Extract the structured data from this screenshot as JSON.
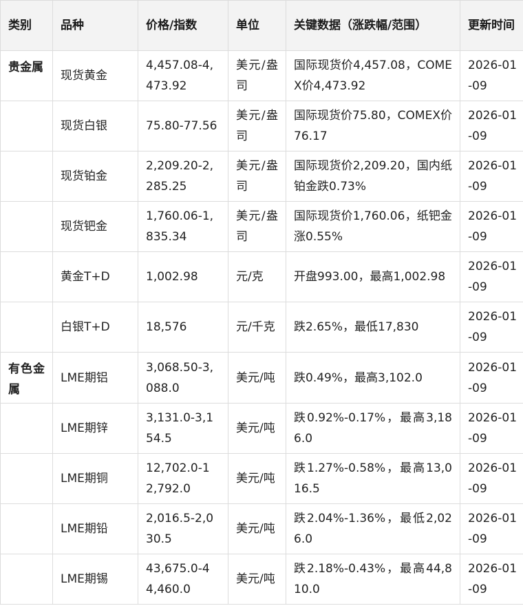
{
  "headers": [
    "类别",
    "品种",
    "价格/指数",
    "单位",
    "关键数据（涨跌幅/范围）",
    "更新时间"
  ],
  "rows": [
    {
      "category": "贵金属",
      "variety": "现货黄金",
      "price": "4,457.08-4,473.92",
      "unit": "美元/盎司",
      "key_data": "国际现货价4,457.08，COMEX价4,473.92",
      "updated": "2026-01-09"
    },
    {
      "category": "",
      "variety": "现货白银",
      "price": "75.80-77.56",
      "unit": "美元/盎司",
      "key_data": "国际现货价75.80，COMEX价76.17",
      "updated": "2026-01-09"
    },
    {
      "category": "",
      "variety": "现货铂金",
      "price": "2,209.20-2,285.25",
      "unit": "美元/盎司",
      "key_data": "国际现货价2,209.20，国内纸铂金跌0.73%",
      "updated": "2026-01-09"
    },
    {
      "category": "",
      "variety": "现货钯金",
      "price": "1,760.06-1,835.34",
      "unit": "美元/盎司",
      "key_data": "国际现货价1,760.06，纸钯金涨0.55%",
      "updated": "2026-01-09"
    },
    {
      "category": "",
      "variety": "黄金T+D",
      "price": "1,002.98",
      "unit": "元/克",
      "key_data": "开盘993.00，最高1,002.98",
      "updated": "2026-01-09"
    },
    {
      "category": "",
      "variety": "白银T+D",
      "price": "18,576",
      "unit": "元/千克",
      "key_data": "跌2.65%，最低17,830",
      "updated": "2026-01-09"
    },
    {
      "category": "有色金属",
      "variety": "LME期铝",
      "price": "3,068.50-3,088.0",
      "unit": "美元/吨",
      "key_data": "跌0.49%，最高3,102.0",
      "updated": "2026-01-09"
    },
    {
      "category": "",
      "variety": "LME期锌",
      "price": "3,131.0-3,154.5",
      "unit": "美元/吨",
      "key_data": "跌0.92%-0.17%，最高3,186.0",
      "updated": "2026-01-09"
    },
    {
      "category": "",
      "variety": "LME期铜",
      "price": "12,702.0-12,792.0",
      "unit": "美元/吨",
      "key_data": "跌1.27%-0.58%，最高13,016.5",
      "updated": "2026-01-09"
    },
    {
      "category": "",
      "variety": "LME期铅",
      "price": "2,016.5-2,030.5",
      "unit": "美元/吨",
      "key_data": "跌2.04%-1.36%，最低2,026.0",
      "updated": "2026-01-09"
    },
    {
      "category": "",
      "variety": "LME期锡",
      "price": "43,675.0-44,460.0",
      "unit": "美元/吨",
      "key_data": "跌2.18%-0.43%，最高44,810.0",
      "updated": "2026-01-09"
    }
  ]
}
